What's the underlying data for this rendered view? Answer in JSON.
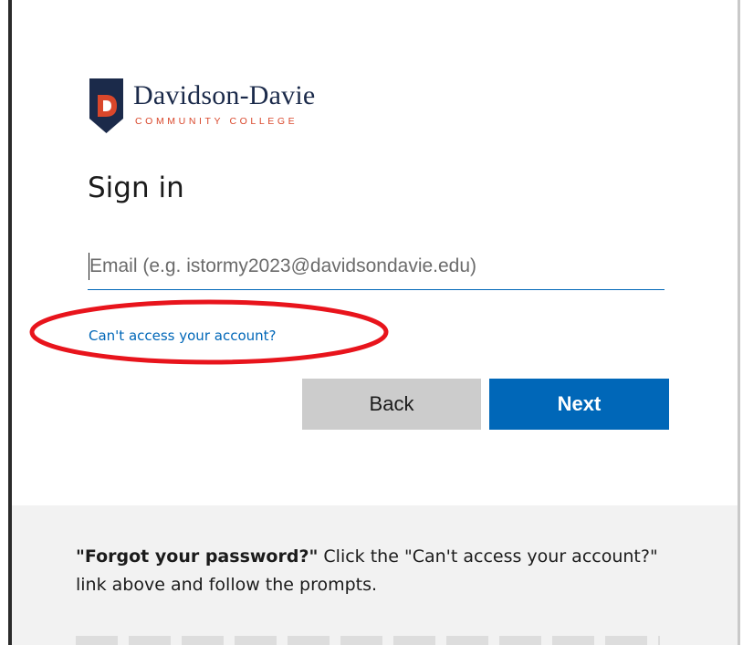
{
  "brand": {
    "name": "Davidson-Davie",
    "subtitle": "COMMUNITY COLLEGE",
    "colors": {
      "navy": "#1b2a4a",
      "red": "#d9472b"
    },
    "logo_icon": "shield-d-logo"
  },
  "signin": {
    "title": "Sign in",
    "email": {
      "value": "",
      "placeholder": "Email (e.g. istormy2023@davidsondavie.edu)"
    },
    "cant_access_link": "Can't access your account?",
    "back_label": "Back",
    "next_label": "Next"
  },
  "help": {
    "bold_lead": "\"Forgot your password?\"",
    "text": " Click the \"Can't access your account?\" link above and follow the prompts."
  },
  "colors": {
    "accent": "#0067b8",
    "back_button": "#cccccc",
    "footer_bg": "#f2f2f2",
    "annotation": "#e8141c"
  }
}
